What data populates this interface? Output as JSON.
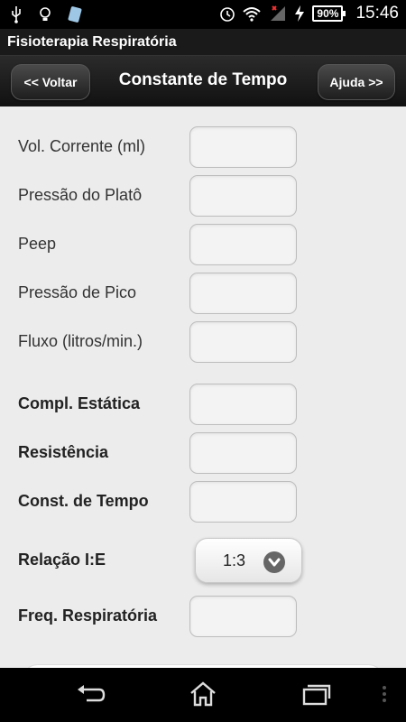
{
  "status_bar": {
    "icons": [
      "usb-icon",
      "lightbulb-icon",
      "app-icon",
      "alarm-icon",
      "wifi-icon",
      "signal-icon",
      "charging-icon"
    ],
    "battery": "90%",
    "time": "15:46"
  },
  "app": {
    "title": "Fisioterapia Respiratória"
  },
  "nav": {
    "back_label": "<< Voltar",
    "title": "Constante de Tempo",
    "help_label": "Ajuda >>"
  },
  "form": {
    "fields": [
      {
        "label": "Vol. Corrente (ml)",
        "value": ""
      },
      {
        "label": "Pressão do Platô",
        "value": ""
      },
      {
        "label": "Peep",
        "value": ""
      },
      {
        "label": "Pressão de Pico",
        "value": ""
      },
      {
        "label": "Fluxo (litros/min.)",
        "value": ""
      }
    ],
    "results": [
      {
        "label": "Compl. Estática",
        "value": ""
      },
      {
        "label": "Resistência",
        "value": ""
      },
      {
        "label": "Const. de Tempo",
        "value": ""
      }
    ],
    "ratio": {
      "label": "Relação I:E",
      "value": "1:3"
    },
    "freq": {
      "label": "Freq. Respiratória",
      "value": ""
    }
  }
}
